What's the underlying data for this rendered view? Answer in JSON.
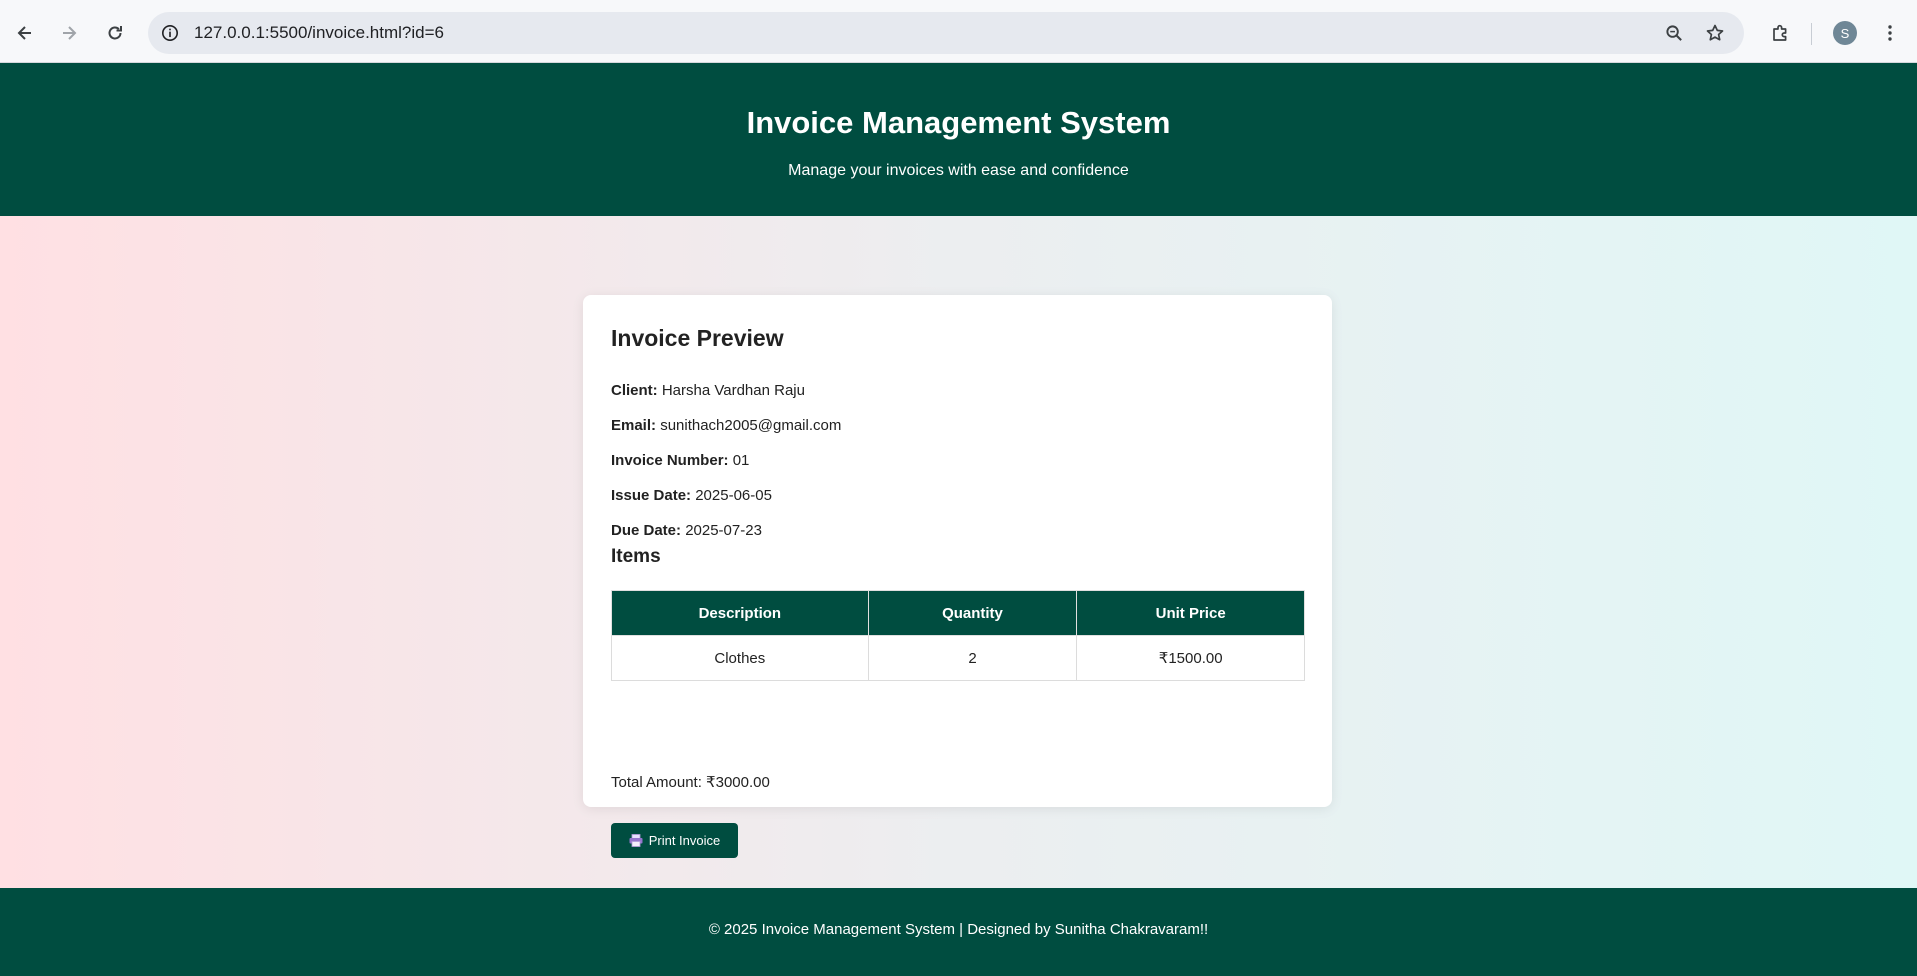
{
  "browser": {
    "url": "127.0.0.1:5500/invoice.html?id=6",
    "profile_initial": "S",
    "icons": [
      "back-arrow-icon",
      "forward-arrow-icon",
      "reload-icon",
      "site-info-icon",
      "zoom-icon",
      "bookmark-star-icon",
      "extensions-icon",
      "more-menu-icon"
    ]
  },
  "header": {
    "title": "Invoice Management System",
    "tagline": "Manage your invoices with ease and confidence"
  },
  "invoice": {
    "heading": "Invoice Preview",
    "client_label": "Client:",
    "client_value": "Harsha Vardhan Raju",
    "email_label": "Email:",
    "email_value": "sunithach2005@gmail.com",
    "number_label": "Invoice Number:",
    "number_value": "01",
    "issue_label": "Issue Date:",
    "issue_value": "2025-06-05",
    "due_label": "Due Date:",
    "due_value": "2025-07-23",
    "items_heading": "Items",
    "columns": [
      "Description",
      "Quantity",
      "Unit Price"
    ],
    "rows": [
      {
        "description": "Clothes",
        "quantity": "2",
        "unit_price": "₹1500.00"
      }
    ],
    "total_text": "Total Amount: ₹3000.00",
    "print_label": "Print Invoice"
  },
  "footer": {
    "text": "© 2025 Invoice Management System | Designed by Sunitha Chakravaram!!"
  },
  "colors": {
    "brand": "#004d40",
    "gradient_left": "#ffe0e3",
    "gradient_right": "#e0f7f6"
  }
}
